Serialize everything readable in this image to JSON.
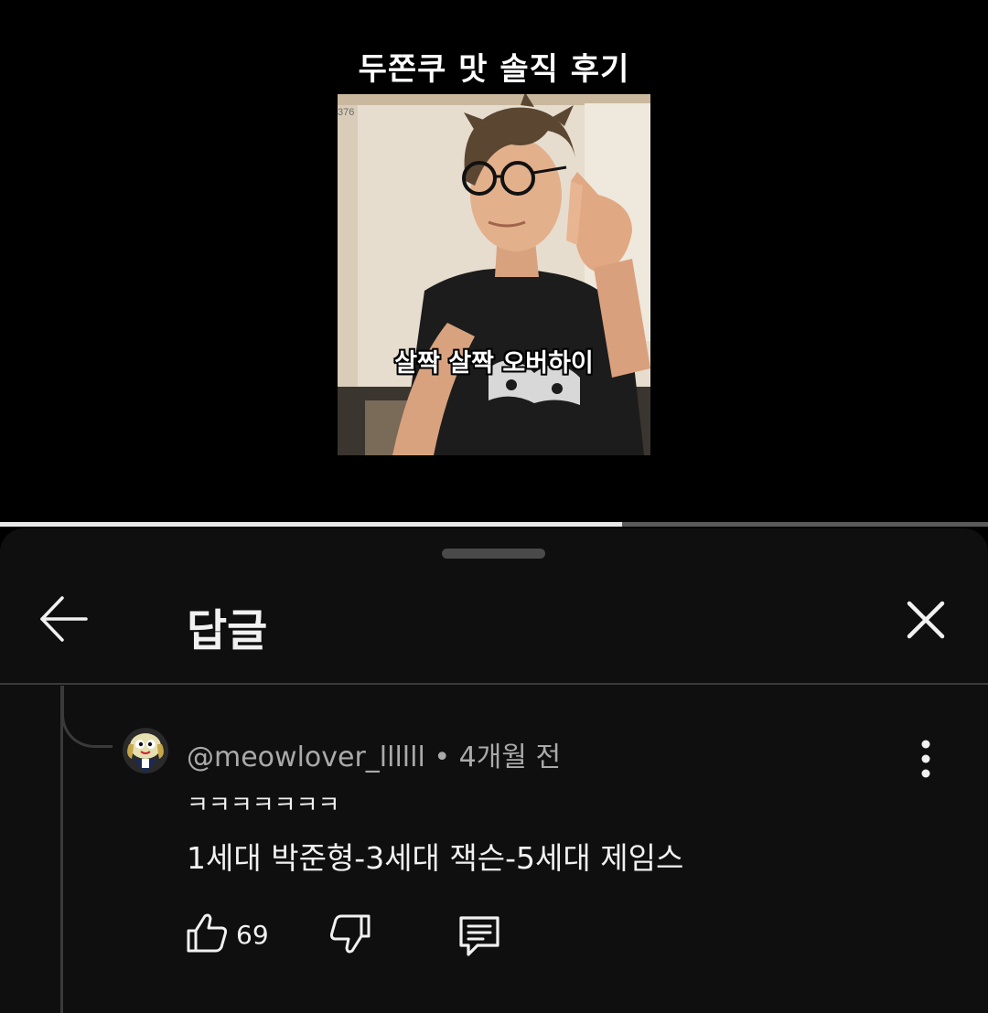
{
  "video": {
    "title": "두쫀쿠 맛 솔직 후기",
    "frame_counter": "376",
    "caption": "살짝 살짝 오버하이",
    "progress_fraction": 0.63
  },
  "replies_panel": {
    "title": "답글",
    "back_icon": "arrow-left-icon",
    "close_icon": "close-icon"
  },
  "comment": {
    "author": "@meowlover_llllll",
    "separator": "•",
    "time": "4개월 전",
    "line1": "ㅋㅋㅋㅋㅋㅋㅋ",
    "line2": "1세대 박준형-3세대 잭슨-5세대 제임스",
    "likes": "69",
    "more_icon": "more-vert-icon",
    "like_icon": "thumbs-up-icon",
    "dislike_icon": "thumbs-down-icon",
    "reply_icon": "reply-comment-icon"
  },
  "colors": {
    "background": "#000000",
    "sheet": "#0f0f0f",
    "secondary_text": "#aaaaaa",
    "divider": "#3a3a3a"
  }
}
